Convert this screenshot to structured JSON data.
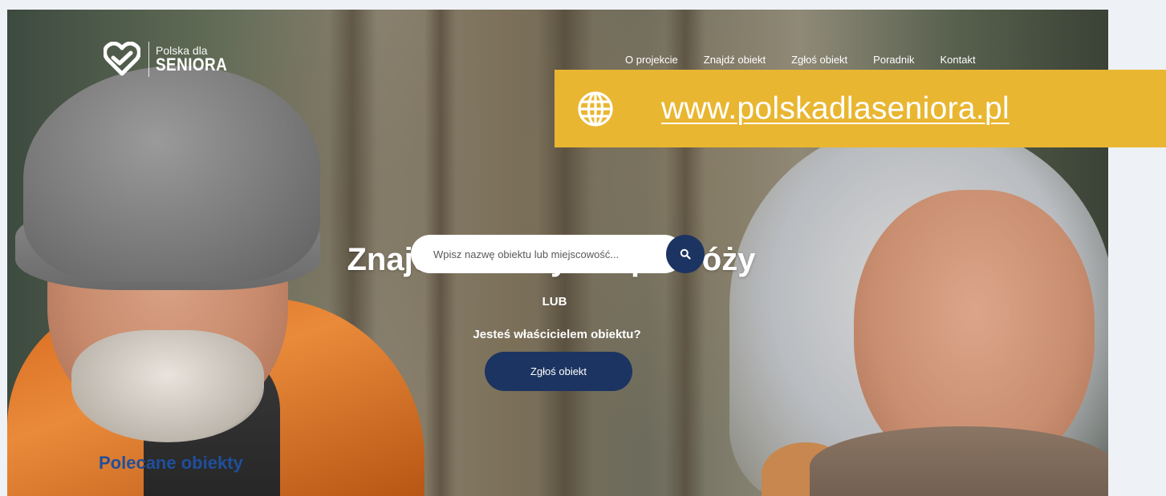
{
  "logo": {
    "line1": "Polska dla",
    "line2": "SENIORA"
  },
  "nav": {
    "items": [
      "O projekcie",
      "Znajdź obiekt",
      "Zgłoś obiekt",
      "Poradnik",
      "Kontakt"
    ]
  },
  "banner": {
    "url": "www.polskadlaseniora.pl",
    "icon": "globe-icon",
    "background": "#e9b631"
  },
  "hero": {
    "title": "Znajdź idealny cel podróży",
    "search_placeholder": "Wpisz nazwę obiektu lub miejscowość...",
    "or_label": "LUB",
    "owner_question": "Jesteś właścicielem obiektu?",
    "report_button": "Zgłoś obiekt"
  },
  "featured": {
    "heading": "Polecane obiekty"
  },
  "colors": {
    "primary": "#1c3461",
    "link_blue": "#1f4f9c",
    "banner_yellow": "#e9b631"
  }
}
